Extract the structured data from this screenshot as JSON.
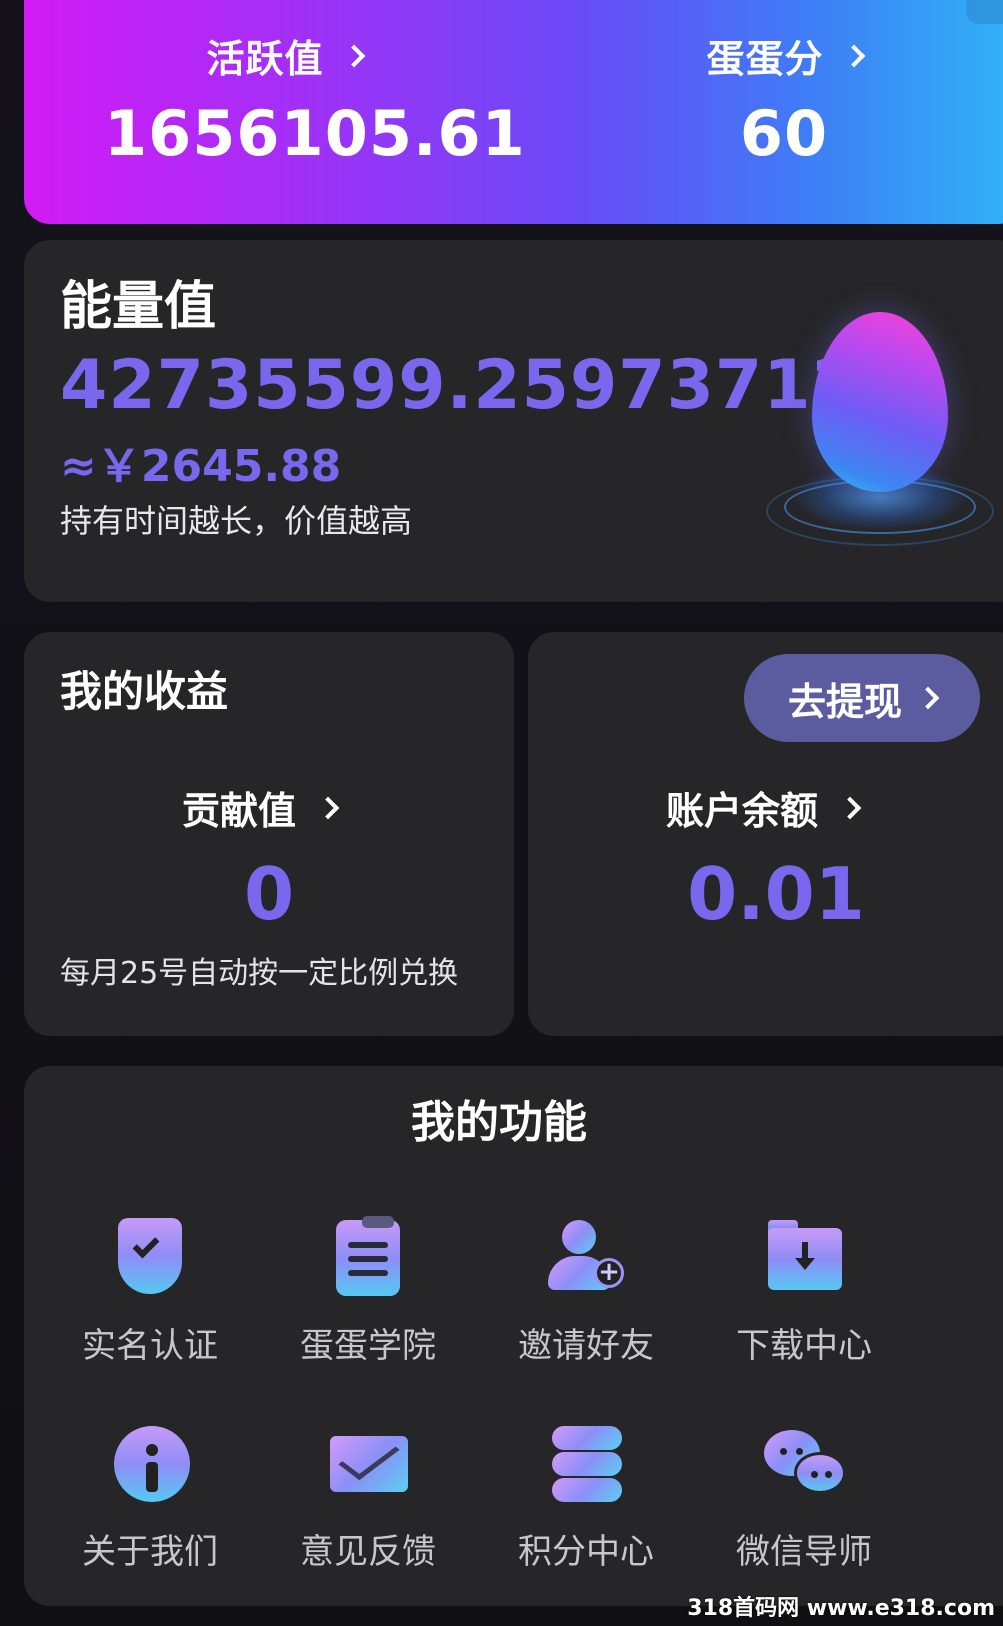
{
  "header": {
    "activity": {
      "label": "活跃值",
      "value": "1656105.61"
    },
    "egg_points": {
      "label": "蛋蛋分",
      "value": "60"
    }
  },
  "energy": {
    "title": "能量值",
    "value": "42735599.25973712",
    "cny": "≈￥2645.88",
    "hint": "持有时间越长，价值越高"
  },
  "earnings": {
    "title": "我的收益",
    "contribution_label": "贡献值",
    "contribution_value": "0",
    "hint": "每月25号自动按一定比例兑换"
  },
  "balance": {
    "withdraw_label": "去提现",
    "label": "账户余额",
    "value": "0.01"
  },
  "functions": {
    "title": "我的功能",
    "items": [
      {
        "label": "实名认证",
        "icon": "shield-check-icon"
      },
      {
        "label": "蛋蛋学院",
        "icon": "clipboard-icon"
      },
      {
        "label": "邀请好友",
        "icon": "add-user-icon"
      },
      {
        "label": "下载中心",
        "icon": "download-folder-icon"
      },
      {
        "label": "关于我们",
        "icon": "info-icon"
      },
      {
        "label": "意见反馈",
        "icon": "mail-icon"
      },
      {
        "label": "积分中心",
        "icon": "database-icon"
      },
      {
        "label": "微信导师",
        "icon": "wechat-icon"
      }
    ]
  },
  "watermark": "318首码网 www.e318.com",
  "colors": {
    "accent": "#7a67ee",
    "card": "#262628",
    "background": "#121016",
    "withdraw_button": "#5b5ba0"
  }
}
